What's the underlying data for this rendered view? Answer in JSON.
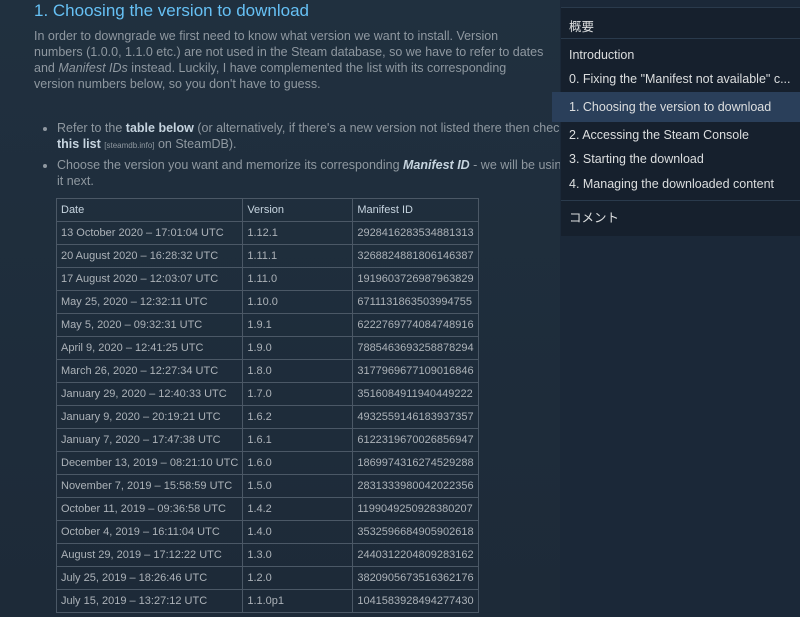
{
  "section": {
    "title": "1. Choosing the version to download",
    "intro_part1": "In order to downgrade we first need to know what version we want to install. Version numbers (1.0.0, 1.1.0 etc.) are not used in the Steam database, so we have to refer to dates and ",
    "intro_italic": "Manifest IDs",
    "intro_part2": " instead. Luckily, I have complemented the list with its corresponding version numbers below, so you don't have to guess."
  },
  "bullets": [
    {
      "pre": "Refer to the ",
      "bold1": "table below",
      "mid": " (or alternatively, if there's a new version not listed there then check ",
      "bold2": "this list",
      "small": "[steamdb.info]",
      "post": "  on SteamDB)."
    },
    {
      "pre": "Choose the version you want and memorize its corresponding ",
      "bold_italic": "Manifest ID",
      "post": " - we will be using it next."
    }
  ],
  "table": {
    "headers": [
      "Date",
      "Version",
      "Manifest ID"
    ],
    "rows": [
      [
        "13 October 2020 – 17:01:04 UTC",
        "1.12.1",
        "2928416283534881313"
      ],
      [
        "20 August 2020 – 16:28:32 UTC",
        "1.11.1",
        "3268824881806146387"
      ],
      [
        "17 August 2020 – 12:03:07 UTC",
        "1.11.0",
        "1919603726987963829"
      ],
      [
        "May 25, 2020 – 12:32:11 UTC",
        "1.10.0",
        "6711131863503994755"
      ],
      [
        "May 5, 2020 – 09:32:31 UTC",
        "1.9.1",
        "6222769774084748916"
      ],
      [
        "April 9, 2020 – 12:41:25 UTC",
        "1.9.0",
        "7885463693258878294"
      ],
      [
        "March 26, 2020 – 12:27:34 UTC",
        "1.8.0",
        "3177969677109016846"
      ],
      [
        "January 29, 2020 – 12:40:33 UTC",
        "1.7.0",
        "3516084911940449222"
      ],
      [
        "January 9, 2020 – 20:19:21 UTC",
        "1.6.2",
        "4932559146183937357"
      ],
      [
        "January 7, 2020 – 17:47:38 UTC",
        "1.6.1",
        "6122319670026856947"
      ],
      [
        "December 13, 2019 – 08:21:10 UTC",
        "1.6.0",
        "1869974316274529288"
      ],
      [
        "November 7, 2019 – 15:58:59 UTC",
        "1.5.0",
        "2831333980042022356"
      ],
      [
        "October 11, 2019 – 09:36:58 UTC",
        "1.4.2",
        "1199049250928380207"
      ],
      [
        "October 4, 2019 – 16:11:04 UTC",
        "1.4.0",
        "3532596684905902618"
      ],
      [
        "August 29, 2019 – 17:12:22 UTC",
        "1.3.0",
        "2440312204809283162"
      ],
      [
        "July 25, 2019 – 18:26:46 UTC",
        "1.2.0",
        "3820905673516362176"
      ],
      [
        "July 15, 2019 – 13:27:12 UTC",
        "1.1.0p1",
        "1041583928494277430"
      ]
    ]
  },
  "toc": {
    "heading": "概要",
    "items": [
      "Introduction",
      "0. Fixing the \"Manifest not available\" c...",
      "1. Choosing the version to download",
      "2. Accessing the Steam Console",
      "3. Starting the download",
      "4. Managing the downloaded content"
    ],
    "active_index": 2,
    "comments": "コメント"
  }
}
